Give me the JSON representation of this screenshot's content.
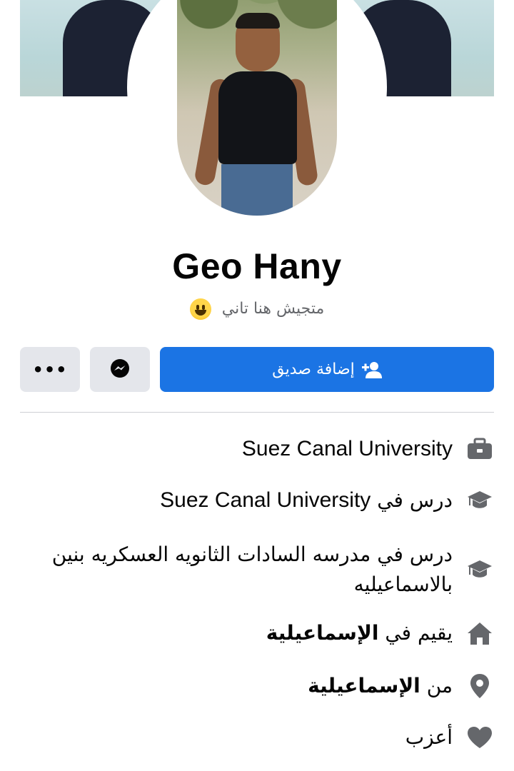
{
  "profile": {
    "name": "Geo Hany",
    "bio_text": "متجيش هنا تاني",
    "bio_emoji": "grinning-face-emoji"
  },
  "actions": {
    "add_friend_label": "إضافة صديق",
    "more_label": "•••",
    "messenger_icon": "messenger-icon"
  },
  "details": {
    "work": "Suez Canal University",
    "studied_prefix": "درس في",
    "studied_at": "Suez Canal University",
    "school_line": "درس في مدرسه السادات الثانويه العسكريه بنين بالاسماعيليه",
    "lives_prefix": "يقيم في",
    "lives_in": "الإسماعيلية",
    "from_prefix": "من",
    "from_place": "الإسماعيلية",
    "relationship": "أعزب"
  },
  "colors": {
    "primary": "#1b74e4",
    "secondary_button": "#e4e6eb",
    "icon_gray": "#65676b"
  }
}
